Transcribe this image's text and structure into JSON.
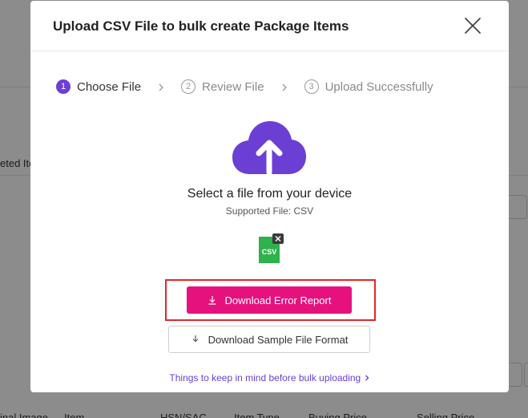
{
  "background": {
    "fragments": [
      "eted Ite",
      "inal Image",
      "Item",
      "HSN/SAC",
      "Item Type",
      "Buying Price",
      "Selling Price"
    ]
  },
  "modal": {
    "title": "Upload CSV File to bulk create Package Items",
    "steps": [
      {
        "number": "1",
        "label": "Choose File",
        "state": "active"
      },
      {
        "number": "2",
        "label": "Review File",
        "state": "inactive"
      },
      {
        "number": "3",
        "label": "Upload Successfully",
        "state": "inactive"
      }
    ],
    "select_title": "Select a file from your device",
    "supported": "Supported File: CSV",
    "file_icon_label": "CSV",
    "error_button": "Download Error Report",
    "sample_button": "Download Sample File Format",
    "tips_link": "Things to keep in mind before bulk uploading"
  },
  "colors": {
    "accent": "#6b3fd4",
    "error_button": "#e5127d",
    "highlight_border": "#e0262b",
    "csv_green": "#2fb24c"
  }
}
